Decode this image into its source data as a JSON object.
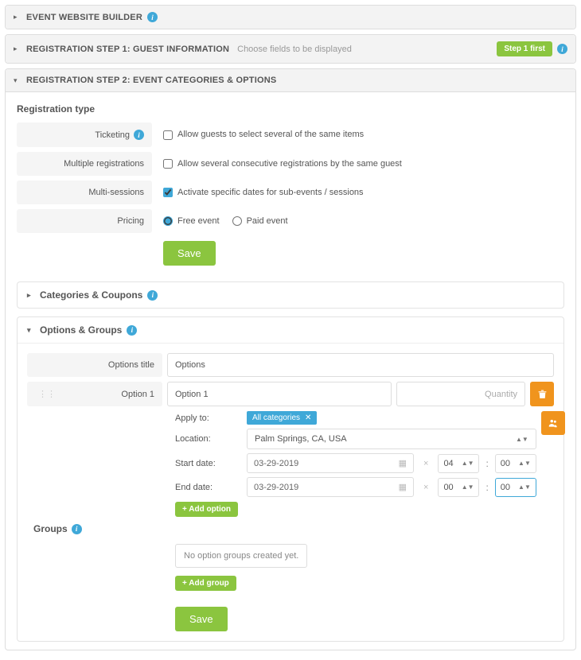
{
  "panels": {
    "website": {
      "title": "EVENT WEBSITE BUILDER"
    },
    "step1": {
      "title": "REGISTRATION STEP 1: GUEST INFORMATION",
      "subtitle": "Choose fields to be displayed",
      "badge": "Step 1 first"
    },
    "step2": {
      "title": "REGISTRATION STEP 2: EVENT CATEGORIES & OPTIONS"
    }
  },
  "regType": {
    "heading": "Registration type",
    "ticketing": {
      "label": "Ticketing",
      "option": "Allow guests to select several of the same items",
      "checked": false
    },
    "multiple": {
      "label": "Multiple registrations",
      "option": "Allow several consecutive registrations by the same guest",
      "checked": false
    },
    "multisessions": {
      "label": "Multi-sessions",
      "option": "Activate specific dates for sub-events / sessions",
      "checked": true
    },
    "pricing": {
      "label": "Pricing",
      "free": "Free event",
      "paid": "Paid event",
      "selected": "free"
    },
    "save": "Save"
  },
  "categories": {
    "title": "Categories & Coupons"
  },
  "options": {
    "title": "Options & Groups",
    "titleRow": {
      "label": "Options title",
      "value": "Options"
    },
    "option1": {
      "label": "Option 1",
      "value": "Option 1",
      "qtyPlaceholder": "Quantity"
    },
    "applyTo": {
      "label": "Apply to:",
      "tag": "All categories"
    },
    "location": {
      "label": "Location:",
      "value": "Palm Springs, CA, USA"
    },
    "startDate": {
      "label": "Start date:",
      "date": "03-29-2019",
      "hh": "04",
      "mm": "00"
    },
    "endDate": {
      "label": "End date:",
      "date": "03-29-2019",
      "hh": "00",
      "mm": "00"
    },
    "addOption": "+  Add option"
  },
  "groups": {
    "title": "Groups",
    "empty": "No option groups created yet.",
    "addGroup": "+  Add group",
    "save": "Save"
  }
}
